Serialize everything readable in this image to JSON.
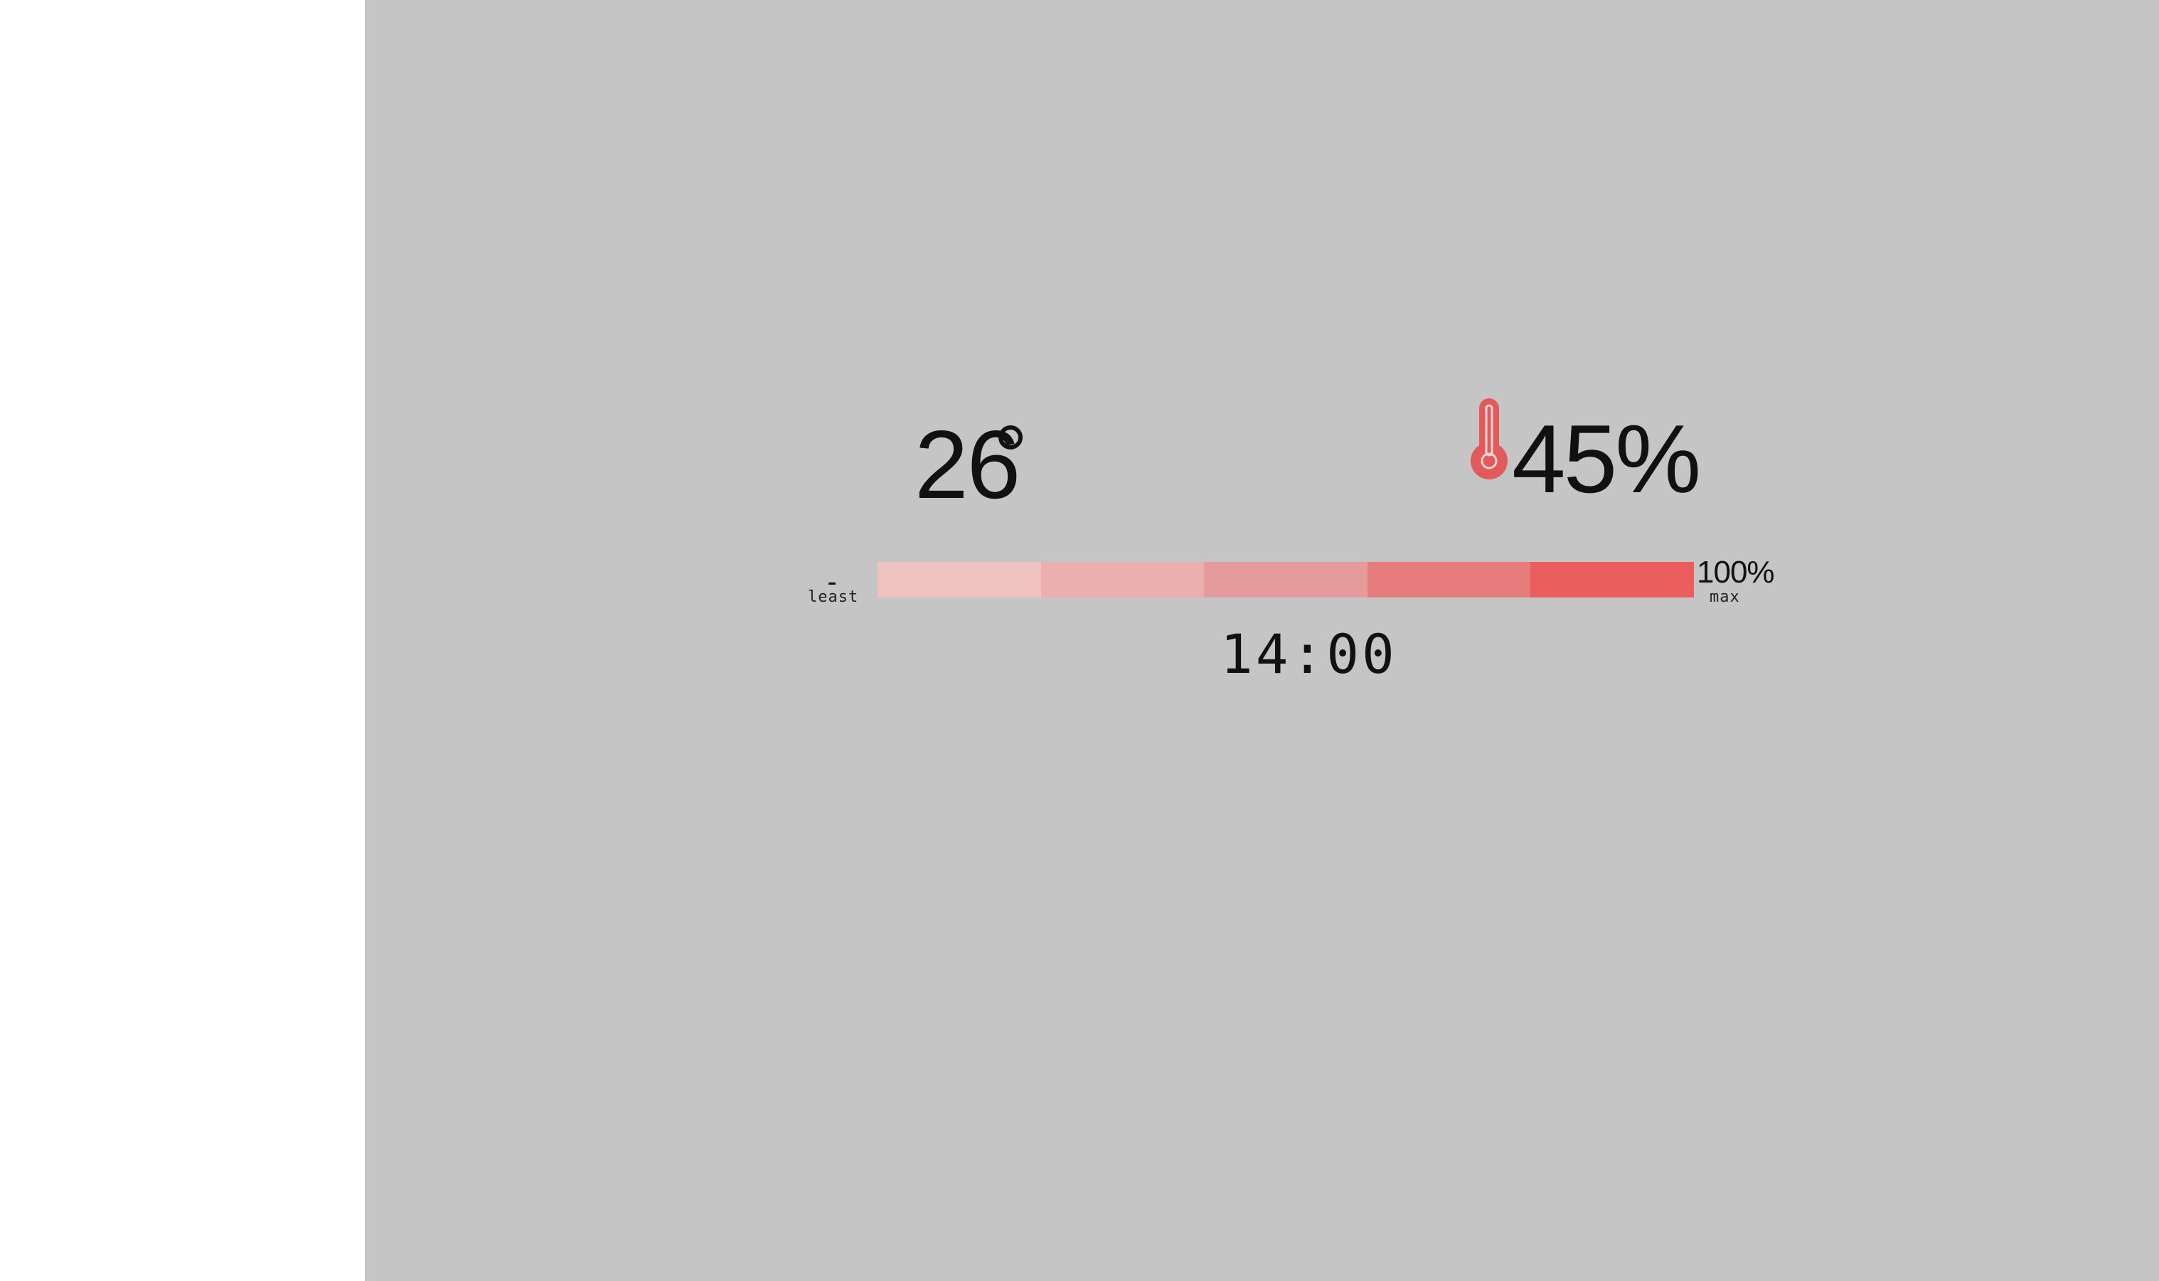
{
  "temperature": {
    "value": "26",
    "unit_symbol": "degree"
  },
  "level": {
    "icon": "thermometer-icon",
    "icon_color": "#e35a5a",
    "value_text": "45%",
    "value": 45
  },
  "scale": {
    "min_marker": "-",
    "min_caption": "least",
    "max_label": "100%",
    "max_caption": "max",
    "segments": [
      {
        "color": "#efc2c2"
      },
      {
        "color": "#ecafaf"
      },
      {
        "color": "#e59a9b"
      },
      {
        "color": "#e67c7b"
      },
      {
        "color": "#ea5e5d"
      }
    ]
  },
  "time": "14:00",
  "colors": {
    "panel_background": "#c5c5c5",
    "outer_background": "#ffffff",
    "text": "#111111"
  }
}
